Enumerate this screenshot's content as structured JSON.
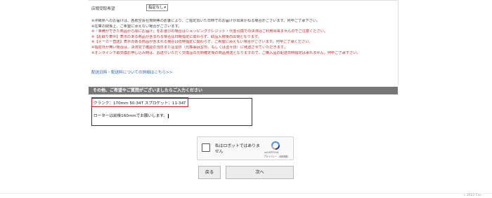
{
  "delivery": {
    "label": "店頭受取希望",
    "select_value": "指定なし"
  },
  "notes": [
    {
      "text": "※沖縄県へのお届けは、各航空会社規制等の影響により、ご指定頂いた日時でのお届けが出来かねる場合がございます。何卒ご了承下さい。",
      "color": "plain"
    },
    {
      "text": "※在庫の関係上、ご希望に添えない場合がございます。",
      "color": "plain"
    },
    {
      "text": "※「准備ができた商品から順にお届け」をお選びの場合はショッピングクレジット・代金引換での決済はご利用出来ませんのでご注意ください。",
      "color": "red"
    },
    {
      "text": "※【お取り寄せ】表示のある商品が含まれる場合は日時指定に関わらず、取品入荷後の出荷となります。",
      "color": "red"
    },
    {
      "text": "※【メーカー直送】表示のある商品が含まれる場合は日時指定に関わらず、ご希望に添えない場合がございます。何卒ご了承ください。",
      "color": "red"
    },
    {
      "text": "※指定日が無い場合は、決済完了確認の当日または翌日（元株事は翌日、もしくは翌々日）に発送させていただきます。",
      "color": "red"
    },
    {
      "text": "※オンライン下取交換お申し込み時は、お送りいただく交換品の元到確定後の商品発送となりますので、ご購入品の配送日時指定は承れません。何卒ご了承下さい。",
      "color": "red"
    }
  ],
  "detail_link": "配送日時・配送料についての詳細はこちら>>",
  "section_title": "その他、ご希望やご質問がございましたらご入力ください",
  "textarea": {
    "line1": "クランク：170mm 50-34T スプロケット：11-34T",
    "line2": "ローターは前後160mmでお願いします。"
  },
  "captcha": {
    "label": "私はロボットではありません",
    "brand": "reCAPTCHA",
    "links": "プライバシー - 利用規約"
  },
  "buttons": {
    "back": "戻る",
    "next": "次へ"
  },
  "footer_text": "c 2022 Car"
}
